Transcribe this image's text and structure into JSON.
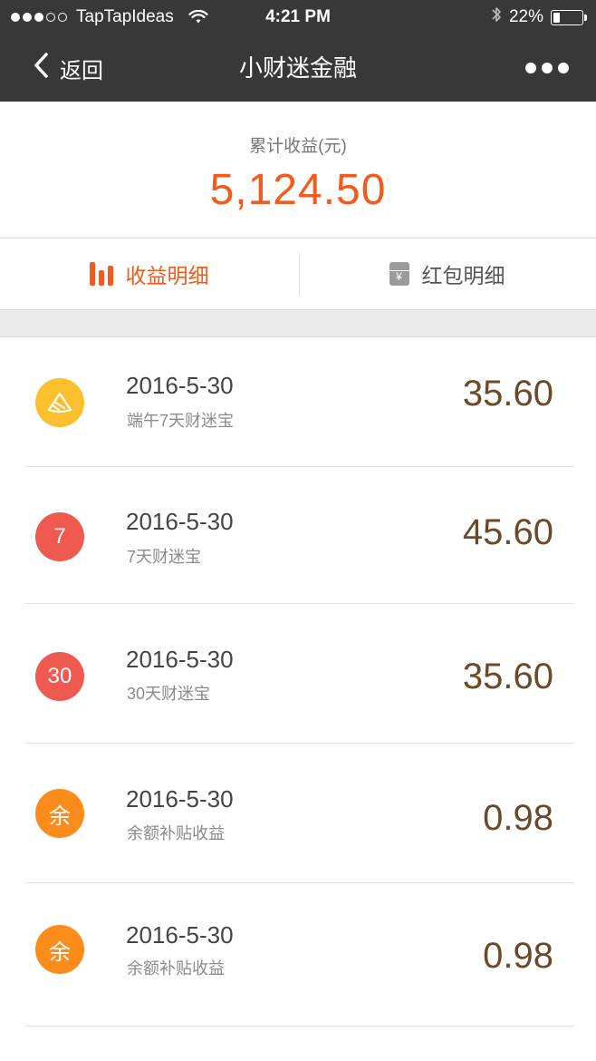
{
  "status_bar": {
    "carrier": "TapTapIdeas",
    "time": "4:21 PM",
    "battery": "22%",
    "battery_level": 0.22
  },
  "nav": {
    "back_label": "返回",
    "title": "小财迷金融"
  },
  "summary": {
    "label": "累计收益(元)",
    "value": "5,124.50"
  },
  "tabs": [
    {
      "label": "收益明细",
      "icon": "bar-chart-icon",
      "active": true
    },
    {
      "label": "红包明细",
      "icon": "red-envelope-icon",
      "active": false
    }
  ],
  "colors": {
    "accent": "#f35a1b",
    "amount": "#6b4a2a",
    "nav_bg": "#383838"
  },
  "items": [
    {
      "date": "2016-5-30",
      "name": "端午7天财迷宝",
      "amount": "35.60",
      "badge_icon": "zongzi-icon",
      "badge_text": "",
      "badge_color": "#fbc02d"
    },
    {
      "date": "2016-5-30",
      "name": "7天财迷宝",
      "amount": "45.60",
      "badge_icon": "seven-icon",
      "badge_text": "7",
      "badge_color": "#ef5a50"
    },
    {
      "date": "2016-5-30",
      "name": "30天财迷宝",
      "amount": "35.60",
      "badge_icon": "thirty-icon",
      "badge_text": "30",
      "badge_color": "#ef5a50"
    },
    {
      "date": "2016-5-30",
      "name": "余额补贴收益",
      "amount": "0.98",
      "badge_icon": "balance-icon",
      "badge_text": "余",
      "badge_color": "#fb8c1c"
    },
    {
      "date": "2016-5-30",
      "name": "余额补贴收益",
      "amount": "0.98",
      "badge_icon": "balance-icon",
      "badge_text": "余",
      "badge_color": "#fb8c1c"
    }
  ]
}
